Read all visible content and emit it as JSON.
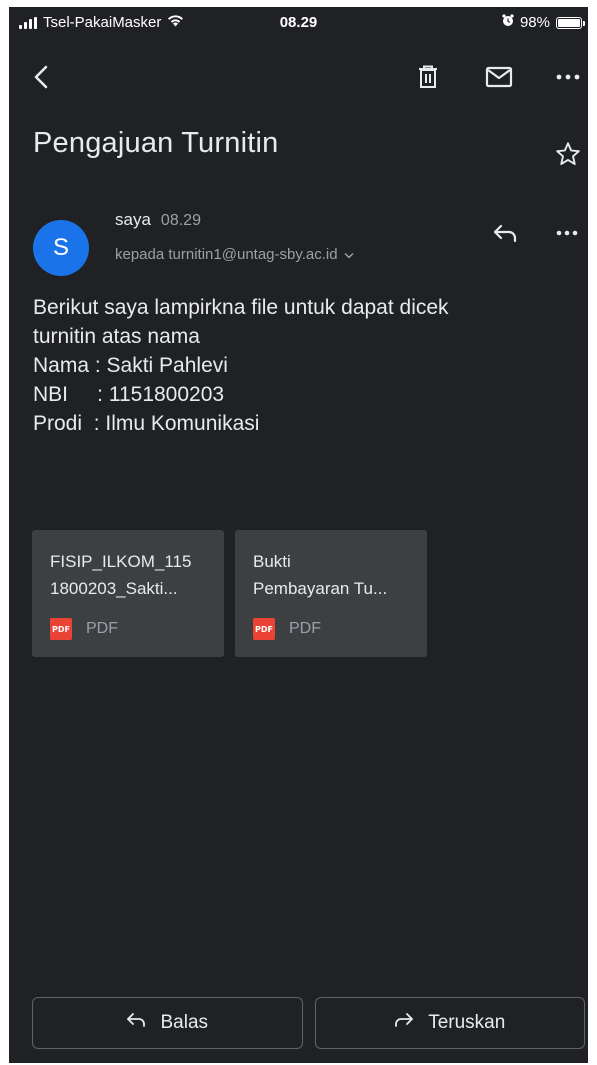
{
  "status_bar": {
    "carrier": "Tsel-PakaiMasker",
    "time": "08.29",
    "battery": "98%",
    "battery_level": 0.98
  },
  "toolbar": {
    "icons": [
      "back-arrow-icon",
      "trash-icon",
      "mail-icon",
      "more-icon"
    ]
  },
  "email": {
    "subject": "Pengajuan Turnitin",
    "sender": {
      "avatar_letter": "S",
      "name": "saya",
      "time": "08.29",
      "recipient": "kepada turnitin1@untag-sby.ac.id"
    },
    "body_lines": [
      "Berikut saya lampirkna file untuk dapat dicek",
      "turnitin atas nama",
      "Nama : Sakti Pahlevi",
      "NBI     : 1151800203",
      "Prodi  : Ilmu Komunikasi"
    ],
    "attachments": [
      {
        "name_line1": "FISIP_ILKOM_115",
        "name_line2": "1800203_Sakti...",
        "type": "PDF",
        "badge": "PDF"
      },
      {
        "name_line1": "Bukti",
        "name_line2": "Pembayaran Tu...",
        "type": "PDF",
        "badge": "PDF"
      }
    ]
  },
  "actions": {
    "reply": "Balas",
    "forward": "Teruskan"
  },
  "colors": {
    "background": "#202124",
    "avatar": "#1a73e8",
    "card": "#3c4043",
    "pdf_badge": "#ea4335"
  }
}
